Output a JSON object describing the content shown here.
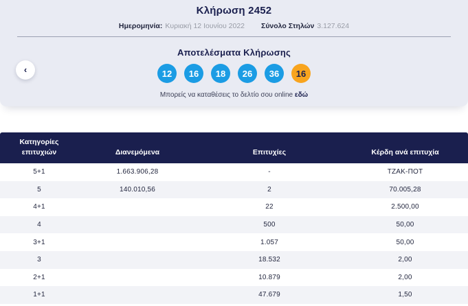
{
  "header": {
    "title": "Κλήρωση 2452",
    "date_label": "Ημερομηνία:",
    "date_value": "Κυριακή 12 Ιουνίου 2022",
    "columns_label": "Σύνολο Στηλών",
    "columns_value": "3.127.624"
  },
  "results": {
    "title": "Αποτελέσματα Κλήρωσης",
    "numbers": [
      "12",
      "16",
      "18",
      "26",
      "36"
    ],
    "joker_number": "16",
    "online_text": "Μπορείς να καταθέσεις το δελτίο σου online",
    "online_link": "εδώ",
    "prev_arrow": "‹"
  },
  "table": {
    "headers": [
      "Κατηγορίες επιτυχιών",
      "Διανεμόμενα",
      "Επιτυχίες",
      "Κέρδη ανά επιτυχία"
    ],
    "rows": [
      {
        "category": "5+1",
        "distributed": "1.663.906,28",
        "wins": "-",
        "prize": "ΤΖΑΚ-ΠΟΤ"
      },
      {
        "category": "5",
        "distributed": "140.010,56",
        "wins": "2",
        "prize": "70.005,28"
      },
      {
        "category": "4+1",
        "distributed": "",
        "wins": "22",
        "prize": "2.500,00"
      },
      {
        "category": "4",
        "distributed": "",
        "wins": "500",
        "prize": "50,00"
      },
      {
        "category": "3+1",
        "distributed": "",
        "wins": "1.057",
        "prize": "50,00"
      },
      {
        "category": "3",
        "distributed": "",
        "wins": "18.532",
        "prize": "2,00"
      },
      {
        "category": "2+1",
        "distributed": "",
        "wins": "10.879",
        "prize": "2,00"
      },
      {
        "category": "1+1",
        "distributed": "",
        "wins": "47.679",
        "prize": "1,50"
      }
    ]
  },
  "colors": {
    "panel_bg": "#E9EBF3",
    "navy": "#1A1F4E",
    "ball_blue": "#1B9CE4",
    "ball_orange": "#F8A41E",
    "row_alt": "#F2F3F7",
    "muted_text": "#989CA6",
    "divider": "#9AA0B1"
  }
}
